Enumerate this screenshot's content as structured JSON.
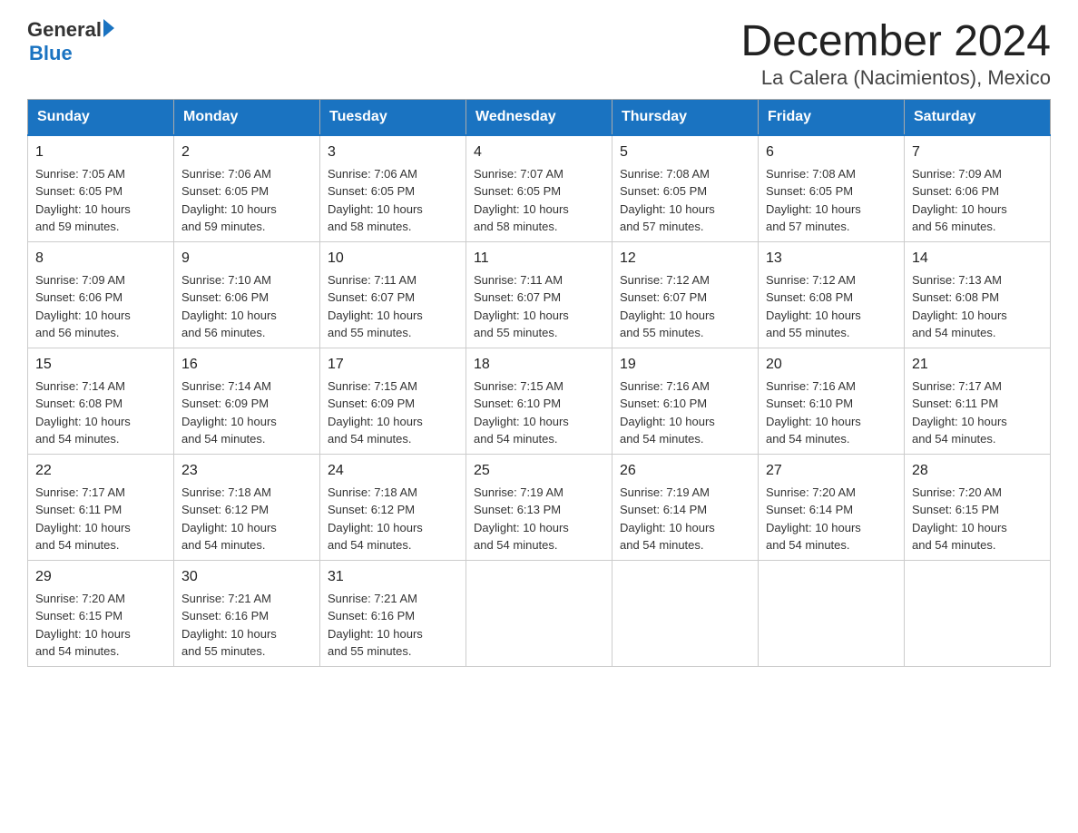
{
  "header": {
    "logo_general": "General",
    "logo_blue": "Blue",
    "title": "December 2024",
    "subtitle": "La Calera (Nacimientos), Mexico"
  },
  "weekdays": [
    "Sunday",
    "Monday",
    "Tuesday",
    "Wednesday",
    "Thursday",
    "Friday",
    "Saturday"
  ],
  "weeks": [
    [
      {
        "day": "1",
        "sunrise": "7:05 AM",
        "sunset": "6:05 PM",
        "daylight": "10 hours and 59 minutes."
      },
      {
        "day": "2",
        "sunrise": "7:06 AM",
        "sunset": "6:05 PM",
        "daylight": "10 hours and 59 minutes."
      },
      {
        "day": "3",
        "sunrise": "7:06 AM",
        "sunset": "6:05 PM",
        "daylight": "10 hours and 58 minutes."
      },
      {
        "day": "4",
        "sunrise": "7:07 AM",
        "sunset": "6:05 PM",
        "daylight": "10 hours and 58 minutes."
      },
      {
        "day": "5",
        "sunrise": "7:08 AM",
        "sunset": "6:05 PM",
        "daylight": "10 hours and 57 minutes."
      },
      {
        "day": "6",
        "sunrise": "7:08 AM",
        "sunset": "6:05 PM",
        "daylight": "10 hours and 57 minutes."
      },
      {
        "day": "7",
        "sunrise": "7:09 AM",
        "sunset": "6:06 PM",
        "daylight": "10 hours and 56 minutes."
      }
    ],
    [
      {
        "day": "8",
        "sunrise": "7:09 AM",
        "sunset": "6:06 PM",
        "daylight": "10 hours and 56 minutes."
      },
      {
        "day": "9",
        "sunrise": "7:10 AM",
        "sunset": "6:06 PM",
        "daylight": "10 hours and 56 minutes."
      },
      {
        "day": "10",
        "sunrise": "7:11 AM",
        "sunset": "6:07 PM",
        "daylight": "10 hours and 55 minutes."
      },
      {
        "day": "11",
        "sunrise": "7:11 AM",
        "sunset": "6:07 PM",
        "daylight": "10 hours and 55 minutes."
      },
      {
        "day": "12",
        "sunrise": "7:12 AM",
        "sunset": "6:07 PM",
        "daylight": "10 hours and 55 minutes."
      },
      {
        "day": "13",
        "sunrise": "7:12 AM",
        "sunset": "6:08 PM",
        "daylight": "10 hours and 55 minutes."
      },
      {
        "day": "14",
        "sunrise": "7:13 AM",
        "sunset": "6:08 PM",
        "daylight": "10 hours and 54 minutes."
      }
    ],
    [
      {
        "day": "15",
        "sunrise": "7:14 AM",
        "sunset": "6:08 PM",
        "daylight": "10 hours and 54 minutes."
      },
      {
        "day": "16",
        "sunrise": "7:14 AM",
        "sunset": "6:09 PM",
        "daylight": "10 hours and 54 minutes."
      },
      {
        "day": "17",
        "sunrise": "7:15 AM",
        "sunset": "6:09 PM",
        "daylight": "10 hours and 54 minutes."
      },
      {
        "day": "18",
        "sunrise": "7:15 AM",
        "sunset": "6:10 PM",
        "daylight": "10 hours and 54 minutes."
      },
      {
        "day": "19",
        "sunrise": "7:16 AM",
        "sunset": "6:10 PM",
        "daylight": "10 hours and 54 minutes."
      },
      {
        "day": "20",
        "sunrise": "7:16 AM",
        "sunset": "6:10 PM",
        "daylight": "10 hours and 54 minutes."
      },
      {
        "day": "21",
        "sunrise": "7:17 AM",
        "sunset": "6:11 PM",
        "daylight": "10 hours and 54 minutes."
      }
    ],
    [
      {
        "day": "22",
        "sunrise": "7:17 AM",
        "sunset": "6:11 PM",
        "daylight": "10 hours and 54 minutes."
      },
      {
        "day": "23",
        "sunrise": "7:18 AM",
        "sunset": "6:12 PM",
        "daylight": "10 hours and 54 minutes."
      },
      {
        "day": "24",
        "sunrise": "7:18 AM",
        "sunset": "6:12 PM",
        "daylight": "10 hours and 54 minutes."
      },
      {
        "day": "25",
        "sunrise": "7:19 AM",
        "sunset": "6:13 PM",
        "daylight": "10 hours and 54 minutes."
      },
      {
        "day": "26",
        "sunrise": "7:19 AM",
        "sunset": "6:14 PM",
        "daylight": "10 hours and 54 minutes."
      },
      {
        "day": "27",
        "sunrise": "7:20 AM",
        "sunset": "6:14 PM",
        "daylight": "10 hours and 54 minutes."
      },
      {
        "day": "28",
        "sunrise": "7:20 AM",
        "sunset": "6:15 PM",
        "daylight": "10 hours and 54 minutes."
      }
    ],
    [
      {
        "day": "29",
        "sunrise": "7:20 AM",
        "sunset": "6:15 PM",
        "daylight": "10 hours and 54 minutes."
      },
      {
        "day": "30",
        "sunrise": "7:21 AM",
        "sunset": "6:16 PM",
        "daylight": "10 hours and 55 minutes."
      },
      {
        "day": "31",
        "sunrise": "7:21 AM",
        "sunset": "6:16 PM",
        "daylight": "10 hours and 55 minutes."
      },
      null,
      null,
      null,
      null
    ]
  ],
  "labels": {
    "sunrise": "Sunrise:",
    "sunset": "Sunset:",
    "daylight": "Daylight:"
  }
}
